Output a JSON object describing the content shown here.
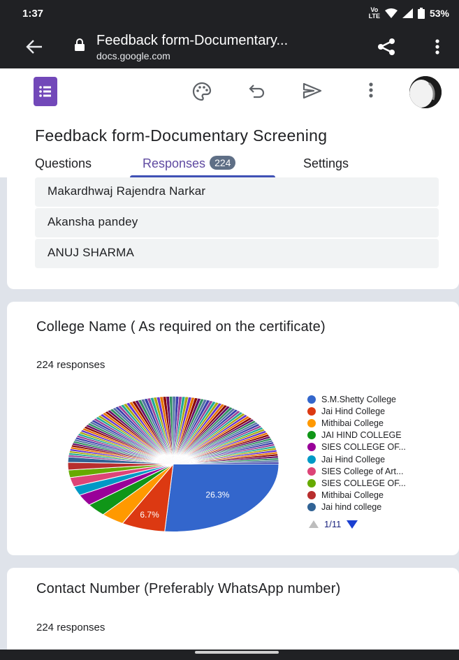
{
  "status": {
    "time": "1:37",
    "network_badge": "Vo LTE",
    "battery": "53%"
  },
  "browser": {
    "page_title": "Feedback form-Documentary...",
    "domain": "docs.google.com"
  },
  "form": {
    "title": "Feedback form-Documentary Screening"
  },
  "tabs": {
    "questions": "Questions",
    "responses": "Responses",
    "responses_count": "224",
    "settings": "Settings"
  },
  "names": [
    "Makardhwaj Rajendra Narkar",
    "Akansha pandey",
    "ANUJ SHARMA"
  ],
  "question_college": {
    "title": "College Name ( As required on the certificate)",
    "count": "224 responses"
  },
  "question_contact": {
    "title": "Contact Number (Preferably WhatsApp number)",
    "count": "224 responses"
  },
  "chart_data": {
    "type": "pie",
    "slices": [
      {
        "label": "S.M.Shetty College",
        "value": 26.3,
        "color": "#3366cc"
      },
      {
        "label": "Jai Hind College",
        "value": 6.7,
        "color": "#dc3912"
      },
      {
        "label": "Mithibai College",
        "value": 3.6,
        "color": "#ff9900"
      },
      {
        "label": "JAI HIND COLLEGE",
        "value": 3.1,
        "color": "#109618"
      },
      {
        "label": "SIES COLLEGE OF...",
        "value": 2.7,
        "color": "#990099"
      },
      {
        "label": "Jai Hind College",
        "value": 2.2,
        "color": "#0099c6"
      },
      {
        "label": "SIES College of Art...",
        "value": 2.2,
        "color": "#dd4477"
      },
      {
        "label": "SIES COLLEGE OF...",
        "value": 1.8,
        "color": "#66aa00"
      },
      {
        "label": "Mithibai College",
        "value": 1.8,
        "color": "#b82e2e"
      },
      {
        "label": "Jai hind college",
        "value": 1.3,
        "color": "#316395"
      }
    ],
    "other_slice_count": 100,
    "other_slice_value": 0.483,
    "palette": [
      "#994499",
      "#22aa99",
      "#aaaa11",
      "#6633cc",
      "#e67300",
      "#8b0707",
      "#651067",
      "#329262",
      "#5574a6",
      "#3b3eac"
    ],
    "data_labels": [
      "26.3%",
      "6.7%"
    ],
    "pager": "1/11"
  }
}
